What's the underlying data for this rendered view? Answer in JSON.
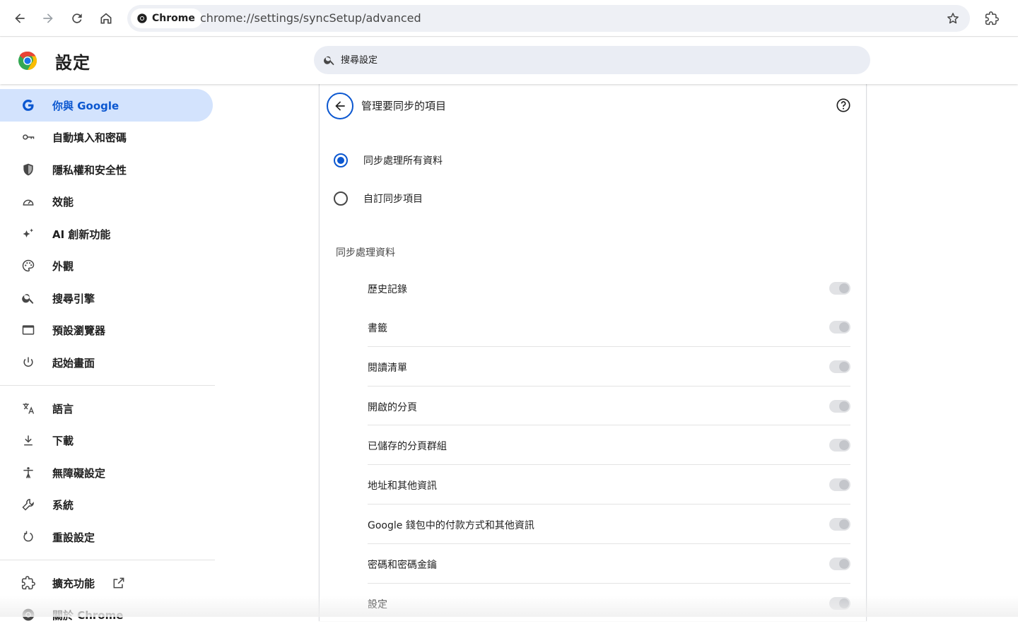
{
  "browser": {
    "chip_label": "Chrome",
    "url": "chrome://settings/syncSetup/advanced",
    "icons": [
      "back-icon",
      "forward-icon",
      "reload-icon",
      "home-icon",
      "chrome-icon",
      "star-icon",
      "extensions-icon"
    ]
  },
  "header": {
    "title": "設定",
    "search_placeholder": "搜尋設定"
  },
  "sidebar": {
    "items": [
      {
        "label": "你與 Google",
        "icon": "google-icon",
        "active": true
      },
      {
        "label": "自動填入和密碼",
        "icon": "key-icon"
      },
      {
        "label": "隱私權和安全性",
        "icon": "shield-icon"
      },
      {
        "label": "效能",
        "icon": "speedometer-icon"
      },
      {
        "label": "AI 創新功能",
        "icon": "sparkle-icon"
      },
      {
        "label": "外觀",
        "icon": "palette-icon"
      },
      {
        "label": "搜尋引擎",
        "icon": "search-icon"
      },
      {
        "label": "預設瀏覽器",
        "icon": "browser-window-icon"
      },
      {
        "label": "起始畫面",
        "icon": "power-icon"
      },
      {
        "label": "語言",
        "icon": "translate-icon"
      },
      {
        "label": "下載",
        "icon": "download-icon"
      },
      {
        "label": "無障礙設定",
        "icon": "accessibility-icon"
      },
      {
        "label": "系統",
        "icon": "wrench-icon"
      },
      {
        "label": "重設設定",
        "icon": "reset-icon"
      },
      {
        "label": "擴充功能",
        "icon": "puzzle-icon"
      },
      {
        "label": "關於 Chrome",
        "icon": "chrome-icon"
      }
    ]
  },
  "main": {
    "page_title": "管理要同步的項目",
    "radio_options": [
      {
        "label": "同步處理所有資料",
        "checked": true
      },
      {
        "label": "自訂同步項目",
        "checked": false
      }
    ],
    "section_title": "同步處理資料",
    "sync_items": [
      {
        "label": "歷史記錄",
        "enabled": true
      },
      {
        "label": "書籤",
        "enabled": true
      },
      {
        "label": "閱讀清單",
        "enabled": true
      },
      {
        "label": "開啟的分頁",
        "enabled": true
      },
      {
        "label": "已儲存的分頁群組",
        "enabled": true
      },
      {
        "label": "地址和其他資訊",
        "enabled": true
      },
      {
        "label": "Google 錢包中的付款方式和其他資訊",
        "enabled": true
      },
      {
        "label": "密碼和密碼金鑰",
        "enabled": true
      },
      {
        "label": "設定",
        "enabled": true
      }
    ]
  },
  "colors": {
    "accent": "#0b57d0",
    "active_nav_bg": "#d3e3fd",
    "search_bg": "#eaedf4"
  }
}
